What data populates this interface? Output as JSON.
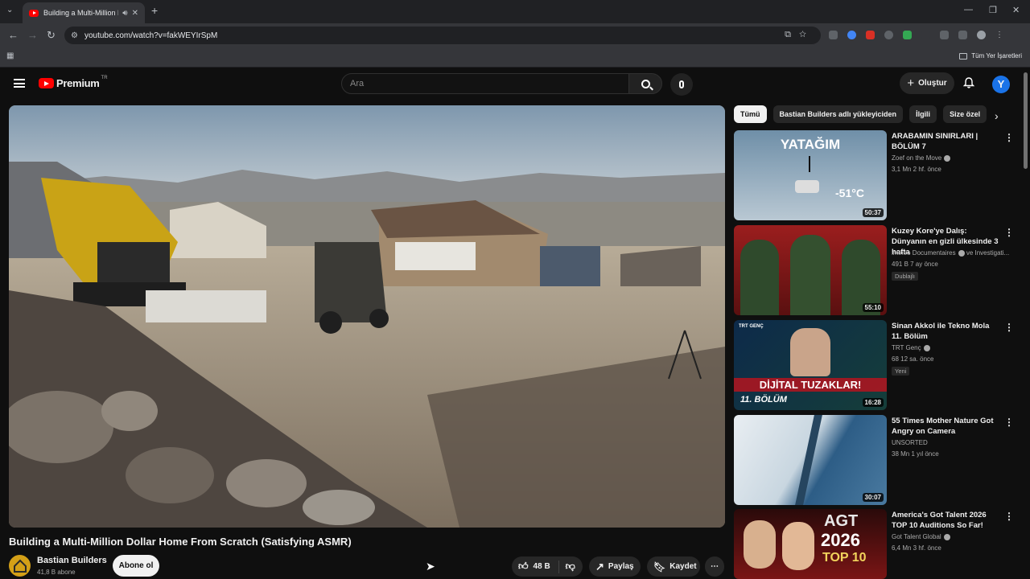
{
  "browser": {
    "tab_title": "Building a Multi-Million Do",
    "url": "youtube.com/watch?v=fakWEYIrSpM",
    "all_bookmarks": "Tüm Yer İşaretleri"
  },
  "header": {
    "logo": "Premium",
    "logo_region": "TR",
    "search_placeholder": "Ara",
    "create_label": "Oluştur",
    "avatar_letter": "Y"
  },
  "video": {
    "title": "Building a Multi-Million Dollar Home From Scratch (Satisfying ASMR)",
    "channel": "Bastian Builders",
    "subscribers": "41,8 B abone",
    "subscribe_label": "Abone ol",
    "likes": "48 B",
    "share_label": "Paylaş",
    "save_label": "Kaydet"
  },
  "chips": [
    "Tümü",
    "Bastian Builders adlı yükleyiciden",
    "İlgili",
    "Size özel"
  ],
  "recommendations": [
    {
      "title": "ARABAMIN SINIRLARI | BÖLÜM 7",
      "channel": "Zoef on the Move",
      "meta": "3,1 Mn  2 hf. önce",
      "duration": "50:37",
      "thumb_text": "YATAĞIM",
      "thumb_temp": "-51°C",
      "badge": ""
    },
    {
      "title": "Kuzey Kore'ye Dalış: Dünyanın en gizli ülkesinde 3 hafta",
      "channel": "imineo Documentaires",
      "channel_extra": "ve Investigati...",
      "meta": "491 B  7 ay önce",
      "duration": "55:10",
      "badge": "Dublajlı"
    },
    {
      "title": "Sinan Akkol ile Tekno Mola 11. Bölüm",
      "channel": "TRT Genç",
      "meta": "68  12 sa. önce",
      "duration": "16:28",
      "thumb_text": "DİJİTAL TUZAKLAR!",
      "thumb_sub": "11. BÖLÜM",
      "thumb_logo": "TRT GENÇ",
      "badge": "Yeni"
    },
    {
      "title": "55 Times Mother Nature Got Angry on Camera",
      "channel": "UNSORTED",
      "meta": "38 Mn  1 yıl önce",
      "duration": "30:07",
      "badge": ""
    },
    {
      "title": "America's Got Talent 2026 TOP 10 Auditions So Far!",
      "channel": "Got Talent Global",
      "meta": "6,4 Mn  3 hf. önce",
      "duration": "",
      "thumb_text": "AGT",
      "thumb_year": "2026",
      "thumb_sub": "TOP 10",
      "badge": ""
    }
  ]
}
